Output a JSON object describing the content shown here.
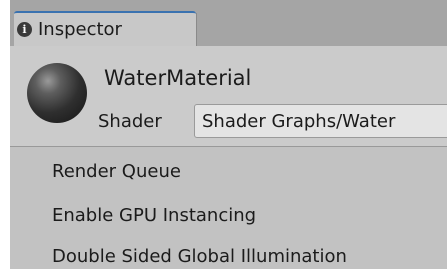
{
  "tab": {
    "icon": "info-icon",
    "title": "Inspector"
  },
  "material": {
    "name": "WaterMaterial",
    "preview_icon": "sphere-preview",
    "shader_label": "Shader",
    "shader_value": "Shader Graphs/Water"
  },
  "properties": [
    {
      "label": "Render Queue"
    },
    {
      "label": "Enable GPU Instancing"
    },
    {
      "label": "Double Sided Global Illumination"
    }
  ]
}
